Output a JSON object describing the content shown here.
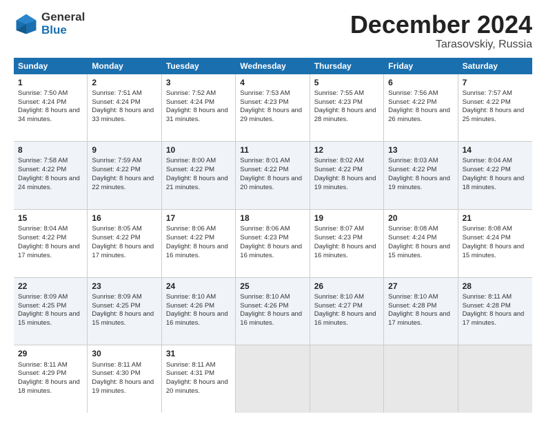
{
  "header": {
    "logo_line1": "General",
    "logo_line2": "Blue",
    "month_title": "December 2024",
    "subtitle": "Tarasovskiy, Russia"
  },
  "days_of_week": [
    "Sunday",
    "Monday",
    "Tuesday",
    "Wednesday",
    "Thursday",
    "Friday",
    "Saturday"
  ],
  "weeks": [
    [
      {
        "day": "1",
        "sunrise": "Sunrise: 7:50 AM",
        "sunset": "Sunset: 4:24 PM",
        "daylight": "Daylight: 8 hours and 34 minutes."
      },
      {
        "day": "2",
        "sunrise": "Sunrise: 7:51 AM",
        "sunset": "Sunset: 4:24 PM",
        "daylight": "Daylight: 8 hours and 33 minutes."
      },
      {
        "day": "3",
        "sunrise": "Sunrise: 7:52 AM",
        "sunset": "Sunset: 4:24 PM",
        "daylight": "Daylight: 8 hours and 31 minutes."
      },
      {
        "day": "4",
        "sunrise": "Sunrise: 7:53 AM",
        "sunset": "Sunset: 4:23 PM",
        "daylight": "Daylight: 8 hours and 29 minutes."
      },
      {
        "day": "5",
        "sunrise": "Sunrise: 7:55 AM",
        "sunset": "Sunset: 4:23 PM",
        "daylight": "Daylight: 8 hours and 28 minutes."
      },
      {
        "day": "6",
        "sunrise": "Sunrise: 7:56 AM",
        "sunset": "Sunset: 4:22 PM",
        "daylight": "Daylight: 8 hours and 26 minutes."
      },
      {
        "day": "7",
        "sunrise": "Sunrise: 7:57 AM",
        "sunset": "Sunset: 4:22 PM",
        "daylight": "Daylight: 8 hours and 25 minutes."
      }
    ],
    [
      {
        "day": "8",
        "sunrise": "Sunrise: 7:58 AM",
        "sunset": "Sunset: 4:22 PM",
        "daylight": "Daylight: 8 hours and 24 minutes."
      },
      {
        "day": "9",
        "sunrise": "Sunrise: 7:59 AM",
        "sunset": "Sunset: 4:22 PM",
        "daylight": "Daylight: 8 hours and 22 minutes."
      },
      {
        "day": "10",
        "sunrise": "Sunrise: 8:00 AM",
        "sunset": "Sunset: 4:22 PM",
        "daylight": "Daylight: 8 hours and 21 minutes."
      },
      {
        "day": "11",
        "sunrise": "Sunrise: 8:01 AM",
        "sunset": "Sunset: 4:22 PM",
        "daylight": "Daylight: 8 hours and 20 minutes."
      },
      {
        "day": "12",
        "sunrise": "Sunrise: 8:02 AM",
        "sunset": "Sunset: 4:22 PM",
        "daylight": "Daylight: 8 hours and 19 minutes."
      },
      {
        "day": "13",
        "sunrise": "Sunrise: 8:03 AM",
        "sunset": "Sunset: 4:22 PM",
        "daylight": "Daylight: 8 hours and 19 minutes."
      },
      {
        "day": "14",
        "sunrise": "Sunrise: 8:04 AM",
        "sunset": "Sunset: 4:22 PM",
        "daylight": "Daylight: 8 hours and 18 minutes."
      }
    ],
    [
      {
        "day": "15",
        "sunrise": "Sunrise: 8:04 AM",
        "sunset": "Sunset: 4:22 PM",
        "daylight": "Daylight: 8 hours and 17 minutes."
      },
      {
        "day": "16",
        "sunrise": "Sunrise: 8:05 AM",
        "sunset": "Sunset: 4:22 PM",
        "daylight": "Daylight: 8 hours and 17 minutes."
      },
      {
        "day": "17",
        "sunrise": "Sunrise: 8:06 AM",
        "sunset": "Sunset: 4:22 PM",
        "daylight": "Daylight: 8 hours and 16 minutes."
      },
      {
        "day": "18",
        "sunrise": "Sunrise: 8:06 AM",
        "sunset": "Sunset: 4:23 PM",
        "daylight": "Daylight: 8 hours and 16 minutes."
      },
      {
        "day": "19",
        "sunrise": "Sunrise: 8:07 AM",
        "sunset": "Sunset: 4:23 PM",
        "daylight": "Daylight: 8 hours and 16 minutes."
      },
      {
        "day": "20",
        "sunrise": "Sunrise: 8:08 AM",
        "sunset": "Sunset: 4:24 PM",
        "daylight": "Daylight: 8 hours and 15 minutes."
      },
      {
        "day": "21",
        "sunrise": "Sunrise: 8:08 AM",
        "sunset": "Sunset: 4:24 PM",
        "daylight": "Daylight: 8 hours and 15 minutes."
      }
    ],
    [
      {
        "day": "22",
        "sunrise": "Sunrise: 8:09 AM",
        "sunset": "Sunset: 4:25 PM",
        "daylight": "Daylight: 8 hours and 15 minutes."
      },
      {
        "day": "23",
        "sunrise": "Sunrise: 8:09 AM",
        "sunset": "Sunset: 4:25 PM",
        "daylight": "Daylight: 8 hours and 15 minutes."
      },
      {
        "day": "24",
        "sunrise": "Sunrise: 8:10 AM",
        "sunset": "Sunset: 4:26 PM",
        "daylight": "Daylight: 8 hours and 16 minutes."
      },
      {
        "day": "25",
        "sunrise": "Sunrise: 8:10 AM",
        "sunset": "Sunset: 4:26 PM",
        "daylight": "Daylight: 8 hours and 16 minutes."
      },
      {
        "day": "26",
        "sunrise": "Sunrise: 8:10 AM",
        "sunset": "Sunset: 4:27 PM",
        "daylight": "Daylight: 8 hours and 16 minutes."
      },
      {
        "day": "27",
        "sunrise": "Sunrise: 8:10 AM",
        "sunset": "Sunset: 4:28 PM",
        "daylight": "Daylight: 8 hours and 17 minutes."
      },
      {
        "day": "28",
        "sunrise": "Sunrise: 8:11 AM",
        "sunset": "Sunset: 4:28 PM",
        "daylight": "Daylight: 8 hours and 17 minutes."
      }
    ],
    [
      {
        "day": "29",
        "sunrise": "Sunrise: 8:11 AM",
        "sunset": "Sunset: 4:29 PM",
        "daylight": "Daylight: 8 hours and 18 minutes."
      },
      {
        "day": "30",
        "sunrise": "Sunrise: 8:11 AM",
        "sunset": "Sunset: 4:30 PM",
        "daylight": "Daylight: 8 hours and 19 minutes."
      },
      {
        "day": "31",
        "sunrise": "Sunrise: 8:11 AM",
        "sunset": "Sunset: 4:31 PM",
        "daylight": "Daylight: 8 hours and 20 minutes."
      },
      null,
      null,
      null,
      null
    ]
  ]
}
